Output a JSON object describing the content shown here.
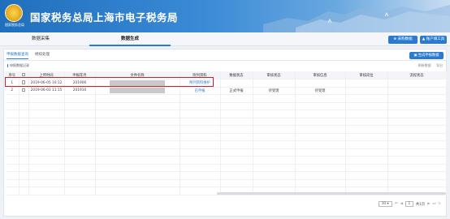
{
  "header": {
    "title": "国家税务总局上海市电子税务局",
    "emblem_caption": "国家税务总局"
  },
  "nav": {
    "tabs": [
      {
        "label": "数据采集"
      },
      {
        "label": "数据生成"
      }
    ],
    "buttons": [
      {
        "label": "采购数据"
      },
      {
        "label": "账户填工具"
      }
    ]
  },
  "subtabs": {
    "items": [
      {
        "label": "申报数据查询"
      },
      {
        "label": "继续处理"
      }
    ],
    "generate_label": "生成申报数据"
  },
  "section": {
    "label": "申报数据记录",
    "tools": [
      "刷新数据",
      "导出"
    ]
  },
  "table": {
    "headers": [
      "序号",
      "",
      "上传时间",
      "申报年月",
      "文件名称",
      "附列资料",
      "数据状态",
      "审核状态",
      "审核信息",
      "审核岗位",
      "流程状态"
    ],
    "rows": [
      {
        "index": "1",
        "upload_time": "2019-06-05 10:12",
        "period": "201906",
        "attachment": "附列资料维护",
        "data_status": "",
        "audit_status": "",
        "audit_info": "",
        "audit_post": "",
        "flow_status": ""
      },
      {
        "index": "2",
        "upload_time": "2019-06-03 11:15",
        "period": "201910",
        "attachment": "已申报",
        "data_status": "正式申报",
        "audit_status": "待受理",
        "audit_info": "待受理",
        "audit_post": "",
        "flow_status": ""
      }
    ]
  },
  "pager": {
    "page_size": "10",
    "page": "1",
    "total": "共1页"
  }
}
